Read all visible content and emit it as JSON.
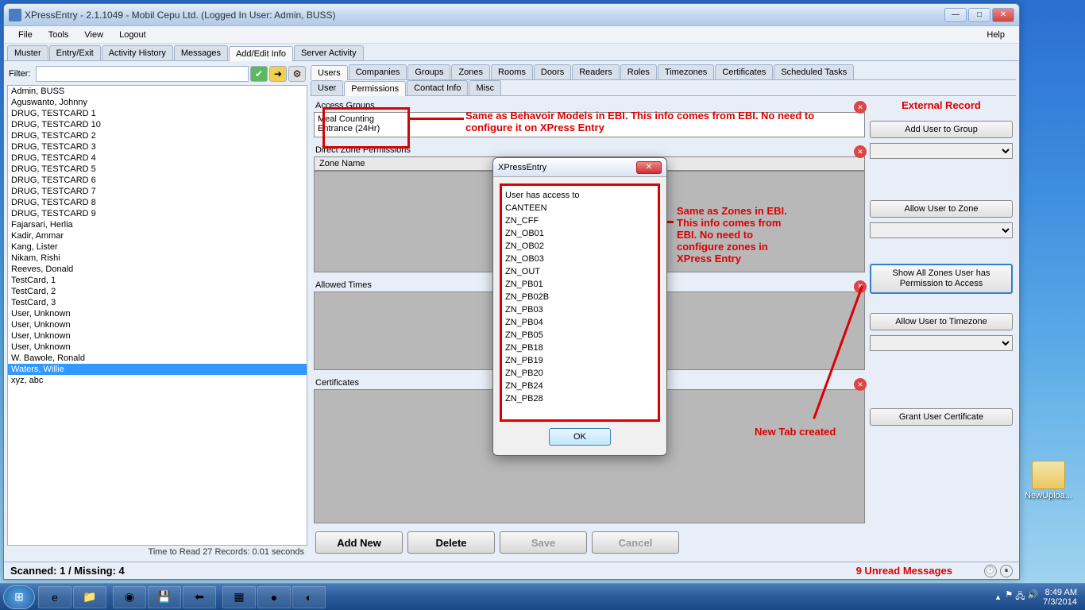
{
  "title": "XPressEntry - 2.1.1049 - Mobil Cepu Ltd. (Logged In User: Admin, BUSS)",
  "menubar": {
    "file": "File",
    "tools": "Tools",
    "view": "View",
    "logout": "Logout",
    "help": "Help"
  },
  "main_tabs": [
    "Muster",
    "Entry/Exit",
    "Activity History",
    "Messages",
    "Add/Edit Info",
    "Server Activity"
  ],
  "main_tab_active": 4,
  "filter_label": "Filter:",
  "users": [
    "Admin, BUSS",
    "Aguswanto, Johnny",
    "DRUG, TESTCARD 1",
    "DRUG, TESTCARD 10",
    "DRUG, TESTCARD 2",
    "DRUG, TESTCARD 3",
    "DRUG, TESTCARD 4",
    "DRUG, TESTCARD 5",
    "DRUG, TESTCARD 6",
    "DRUG, TESTCARD 7",
    "DRUG, TESTCARD 8",
    "DRUG, TESTCARD 9",
    "Fajarsari, Herlia",
    "Kadir, Ammar",
    "Kang, Lister",
    "Nikam, Rishi",
    "Reeves, Donald",
    "TestCard, 1",
    "TestCard, 2",
    "TestCard, 3",
    "User, Unknown",
    "User, Unknown",
    "User, Unknown",
    "User, Unknown",
    "W. Bawole, Ronald",
    "Waters, Willie",
    "xyz, abc"
  ],
  "selected_user_index": 25,
  "time_label": "Time to Read 27 Records: 0.01 seconds",
  "top_tabs": [
    "Users",
    "Companies",
    "Groups",
    "Zones",
    "Rooms",
    "Doors",
    "Readers",
    "Roles",
    "Timezones",
    "Certificates",
    "Scheduled Tasks"
  ],
  "top_tab_active": 0,
  "sub_tabs": [
    "User",
    "Permissions",
    "Contact Info",
    "Misc"
  ],
  "sub_tab_active": 1,
  "sections": {
    "access_groups_label": "Access Groups",
    "access_groups_items": [
      "Meal Counting",
      "Entrance (24Hr)"
    ],
    "direct_zone_label": "Direct Zone Permissions",
    "zone_name_header": "Zone Name",
    "allowed_times_label": "Allowed Times",
    "certificates_label": "Certificates"
  },
  "side": {
    "external_record": "External Record",
    "add_group": "Add User to Group",
    "allow_zone": "Allow User to Zone",
    "show_zones": "Show All Zones User has Permission to Access",
    "allow_tz": "Allow User to Timezone",
    "grant_cert": "Grant User Certificate"
  },
  "bottom_buttons": {
    "add": "Add New",
    "delete": "Delete",
    "save": "Save",
    "cancel": "Cancel"
  },
  "dialog": {
    "title": "XPressEntry",
    "heading": "User has access to",
    "zones": [
      "CANTEEN",
      "ZN_CFF",
      "ZN_OB01",
      "ZN_OB02",
      "ZN_OB03",
      "ZN_OUT",
      "ZN_PB01",
      "ZN_PB02B",
      "ZN_PB03",
      "ZN_PB04",
      "ZN_PB05",
      "ZN_PB18",
      "ZN_PB19",
      "ZN_PB20",
      "ZN_PB24",
      "ZN_PB28"
    ],
    "ok": "OK"
  },
  "annotations": {
    "a1": "Same as Behavoir Models in EBI. This info comes from EBI. No need to configure it on XPress Entry",
    "a2": "Same as Zones in EBI. This info comes from EBI. No need to configure zones in XPress Entry",
    "a3": "New Tab created"
  },
  "status": {
    "scanned": "Scanned: 1 / Missing: 4",
    "unread": "9 Unread Messages"
  },
  "desktop_icon": "NewUploa...",
  "clock": {
    "time": "8:49 AM",
    "date": "7/3/2014"
  }
}
